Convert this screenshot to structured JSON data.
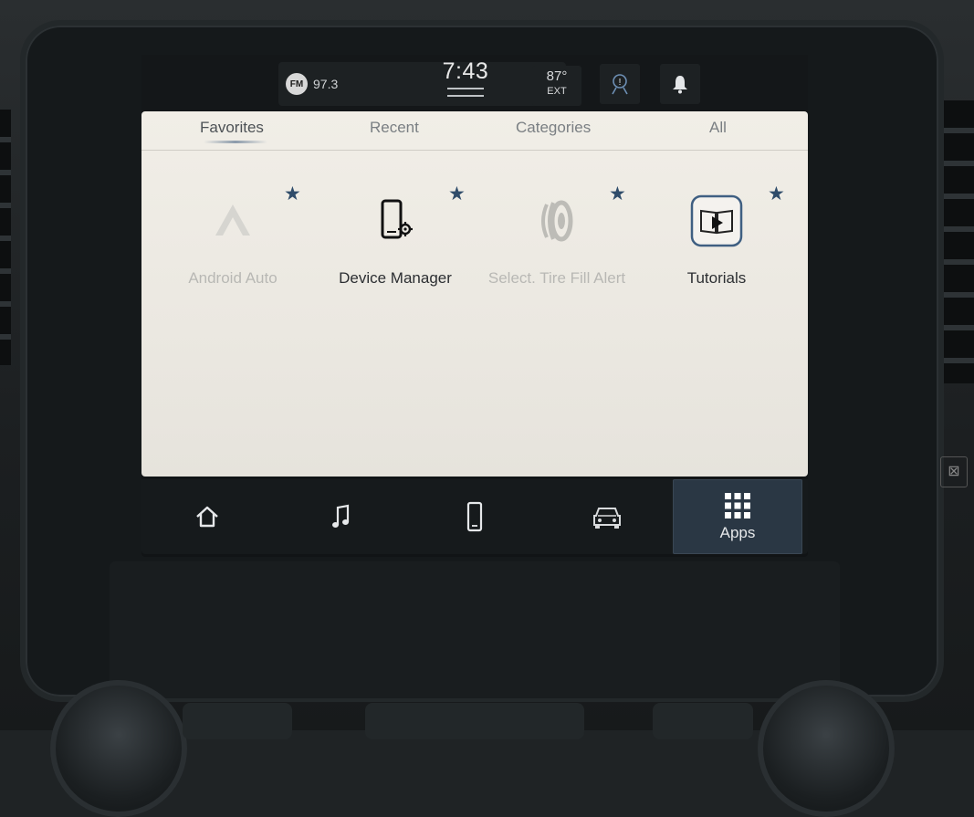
{
  "status_bar": {
    "radio_badge": "FM",
    "radio_frequency": "97.3",
    "clock": "7:43",
    "temperature": "87°",
    "temperature_label": "EXT",
    "icons": [
      "driver-assist-icon",
      "notification-bell-icon"
    ]
  },
  "tabs": [
    {
      "label": "Favorites",
      "active": true
    },
    {
      "label": "Recent",
      "active": false
    },
    {
      "label": "Categories",
      "active": false
    },
    {
      "label": "All",
      "active": false
    }
  ],
  "apps": [
    {
      "label": "Android Auto",
      "icon": "android-auto-icon",
      "enabled": false,
      "favorite": true
    },
    {
      "label": "Device Manager",
      "icon": "device-manager-icon",
      "enabled": true,
      "favorite": true
    },
    {
      "label": "Select. Tire Fill Alert",
      "icon": "tire-icon",
      "enabled": false,
      "favorite": true
    },
    {
      "label": "Tutorials",
      "icon": "tutorials-icon",
      "enabled": true,
      "favorite": true
    }
  ],
  "nav": [
    {
      "icon": "home-icon"
    },
    {
      "icon": "music-note-icon"
    },
    {
      "icon": "phone-icon"
    },
    {
      "icon": "vehicle-icon"
    },
    {
      "icon": "apps-grid-icon",
      "label": "Apps",
      "active": true
    }
  ],
  "colors": {
    "panel_bg": "#ede9e2",
    "star": "#2f4c6a",
    "nav_active": "#2a3744"
  }
}
